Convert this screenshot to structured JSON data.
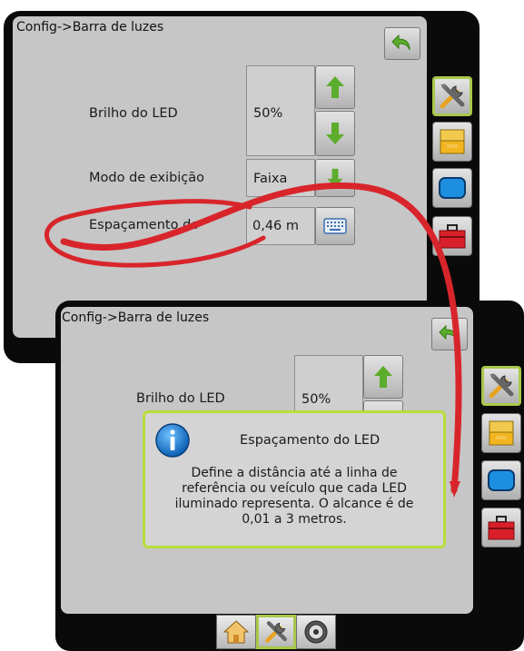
{
  "back_screen": {
    "breadcrumb": "Config->Barra de luzes",
    "rows": {
      "led_brightness": {
        "label": "Brilho do LED",
        "value": "50%"
      },
      "display_mode": {
        "label": "Modo de exibição",
        "value": "Faixa"
      },
      "led_spacing": {
        "label": "Espaçamento do",
        "value": "0,46 m"
      }
    }
  },
  "front_screen": {
    "breadcrumb": "Config->Barra de luzes",
    "rows": {
      "led_brightness": {
        "label": "Brilho do LED",
        "value": "50%"
      }
    },
    "popup": {
      "title": "Espaçamento do LED",
      "body": "Define a distância até a linha de referência ou veículo que cada LED iluminado representa. O alcance é de 0,01 a 3 metros."
    }
  },
  "side_tabs": [
    "tools-icon",
    "console-icon",
    "screen-icon",
    "toolbox-icon"
  ],
  "bottom_nav": [
    "home-icon",
    "tools-icon",
    "gauge-icon"
  ],
  "colors": {
    "highlight_red": "#d8252b",
    "active_green": "#a9c84a",
    "popup_border": "#b7dd3a",
    "arrow_green": "#5cad2b",
    "info_blue": "#1f7fd4"
  }
}
